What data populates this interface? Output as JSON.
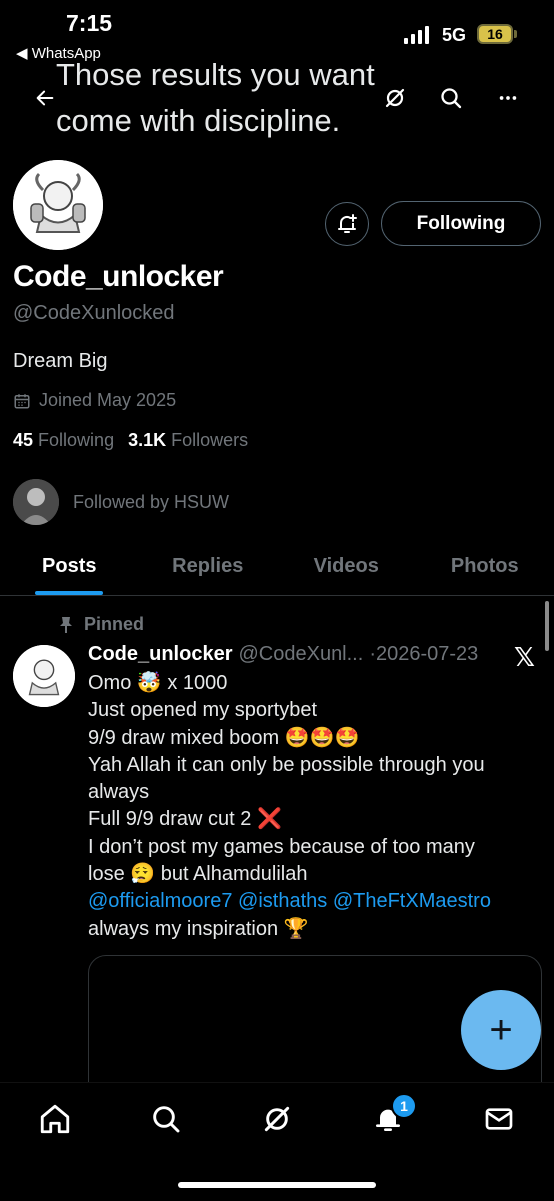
{
  "status_bar": {
    "time": "7:15",
    "back_app": "◀ WhatsApp",
    "network": "5G",
    "battery": "16"
  },
  "header": {
    "banner_text": "Those results you want come with discipline."
  },
  "profile": {
    "name": "Code_unlocker",
    "handle": "@CodeXunlocked",
    "bio": "Dream Big",
    "joined": "Joined May 2025",
    "following_count": "45",
    "following_label": "Following",
    "followers_count": "3.1K",
    "followers_label": "Followers",
    "followed_by": "Followed by HSUW",
    "follow_button": "Following"
  },
  "tabs": [
    "Posts",
    "Replies",
    "Videos",
    "Photos"
  ],
  "post": {
    "pinned_label": "Pinned",
    "author": "Code_unlocker",
    "handle": "@CodeXunl...",
    "date": "·2026-07-23",
    "x_logo": "𝕏",
    "lines": {
      "l1": "Omo 🤯 x 1000",
      "l2": "Just opened my sportybet",
      "l3": "9/9 draw mixed boom 🤩🤩🤩",
      "l4": "Yah Allah it can only be possible through you",
      "l5": "always",
      "l6": "Full 9/9 draw cut 2 ❌",
      "l7": "I don’t post my games because of too many",
      "l8a": "lose 😮‍💨 but Alhamdulilah",
      "mention1": "@officialmoore7",
      "mention2": "@isthaths",
      "mention3": "@TheFtXMaestro",
      "l10": "always my inspiration 🏆"
    }
  },
  "fab_label": "+",
  "nav": {
    "notifications_badge": "1"
  },
  "colors": {
    "accent": "#1d9bf0",
    "background": "#000000",
    "muted": "#71767b"
  }
}
